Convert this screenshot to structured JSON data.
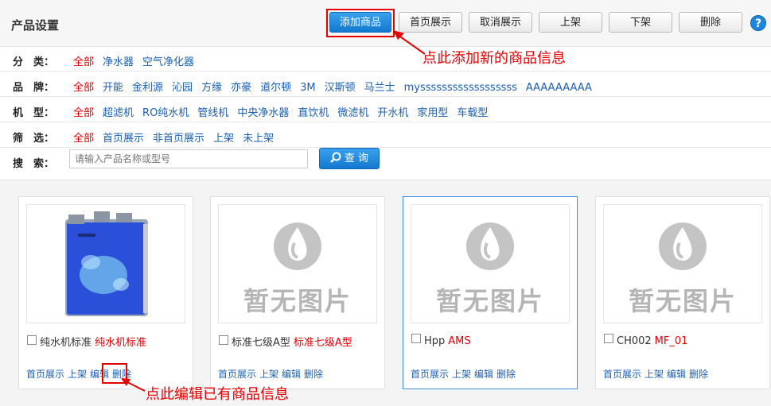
{
  "header": {
    "title": "产品设置",
    "buttons": [
      "添加商品",
      "首页展示",
      "取消展示",
      "上架",
      "下架",
      "删除"
    ],
    "help": "?"
  },
  "annotations": {
    "add_hint": "点此添加新的商品信息",
    "edit_hint": "点此编辑已有商品信息"
  },
  "filters": {
    "category": {
      "label": "分　类：",
      "options": [
        "全部",
        "净水器",
        "空气净化器"
      ]
    },
    "brand": {
      "label": "品　牌：",
      "options": [
        "全部",
        "开能",
        "金利源",
        "沁园",
        "方缘",
        "亦豪",
        "道尔顿",
        "3M",
        "汉斯顿",
        "马兰士",
        "myssssssssssssssssss",
        "AAAAAAAAA"
      ]
    },
    "model": {
      "label": "机　型：",
      "options": [
        "全部",
        "超滤机",
        "RO纯水机",
        "管线机",
        "中央净水器",
        "直饮机",
        "微滤机",
        "开水机",
        "家用型",
        "车载型"
      ]
    },
    "screen": {
      "label": "筛　选：",
      "options": [
        "全部",
        "首页展示",
        "非首页展示",
        "上架",
        "未上架"
      ]
    },
    "search": {
      "label": "搜　索：",
      "placeholder": "请输入产品名称或型号",
      "button": "查 询"
    }
  },
  "products": [
    {
      "name": "纯水机标准",
      "model": "纯水机标准",
      "image": "product-photo",
      "actions": [
        "首页展示",
        "上架",
        "编辑",
        "删除"
      ]
    },
    {
      "name": "标准七级A型",
      "model": "标准七级A型",
      "image": "no-image",
      "actions": [
        "首页展示",
        "上架",
        "编辑",
        "删除"
      ]
    },
    {
      "name": "Hpp",
      "model": "AMS",
      "image": "no-image",
      "actions": [
        "首页展示",
        "上架",
        "编辑",
        "删除"
      ]
    },
    {
      "name": "CH002",
      "model": "MF_01",
      "image": "no-image",
      "actions": [
        "首页展示",
        "上架",
        "编辑",
        "删除"
      ]
    }
  ],
  "no_image_text": "暂无图片",
  "colors": {
    "accent": "#1279cf",
    "highlight": "#e60000",
    "link": "#1a5fb4"
  }
}
